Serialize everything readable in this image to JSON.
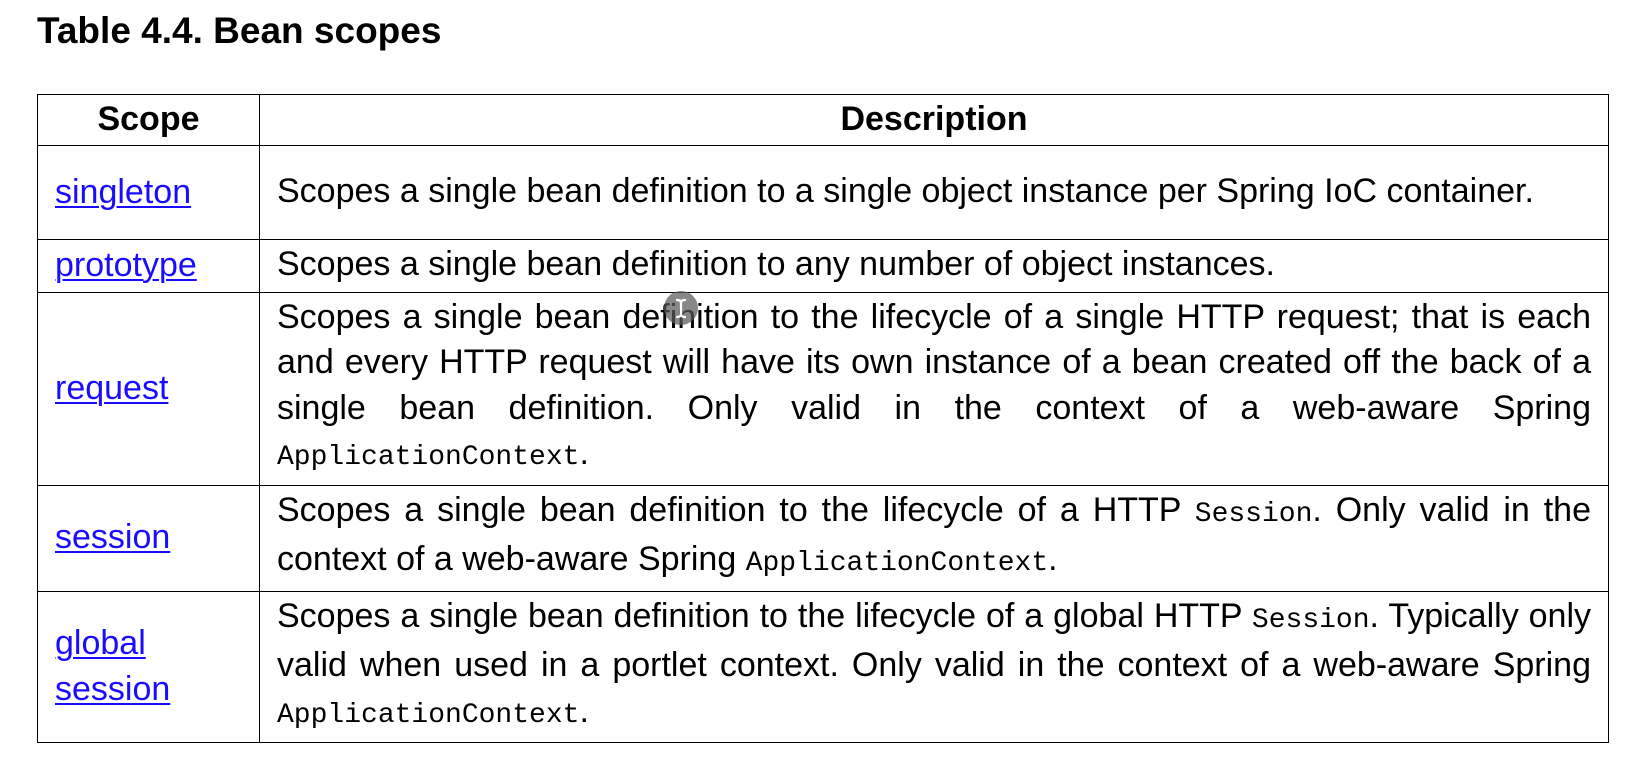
{
  "caption": "Table 4.4. Bean scopes",
  "table": {
    "headers": {
      "scope": "Scope",
      "description": "Description"
    },
    "rows": [
      {
        "scope": "singleton",
        "parts": [
          "Scopes a single bean definition to a single object instance per Spring IoC container."
        ]
      },
      {
        "scope": "prototype",
        "parts": [
          "Scopes a single bean definition to any number of object instances."
        ]
      },
      {
        "scope": "request",
        "parts": [
          "Scopes a single bean definition to the lifecycle of a single HTTP request; that is each and every HTTP request will have its own instance of a bean created off the back of a single bean definition. Only valid in the context of a web-aware Spring ",
          "ApplicationContext",
          "."
        ]
      },
      {
        "scope": "session",
        "parts": [
          "Scopes a single bean definition to the lifecycle of a HTTP ",
          "Session",
          ". Only valid in the context of a web-aware Spring ",
          "ApplicationContext",
          "."
        ]
      },
      {
        "scope": "global session",
        "parts": [
          "Scopes a single bean definition to the lifecycle of a global HTTP ",
          "Session",
          ". Typically only valid when used in a portlet context. Only valid in the context of a web-aware Spring ",
          "ApplicationContext",
          "."
        ]
      }
    ]
  },
  "style": {
    "link_color": "#1a0dff",
    "border_color": "#000000"
  },
  "cursor": {
    "icon": "text-cursor-icon"
  }
}
